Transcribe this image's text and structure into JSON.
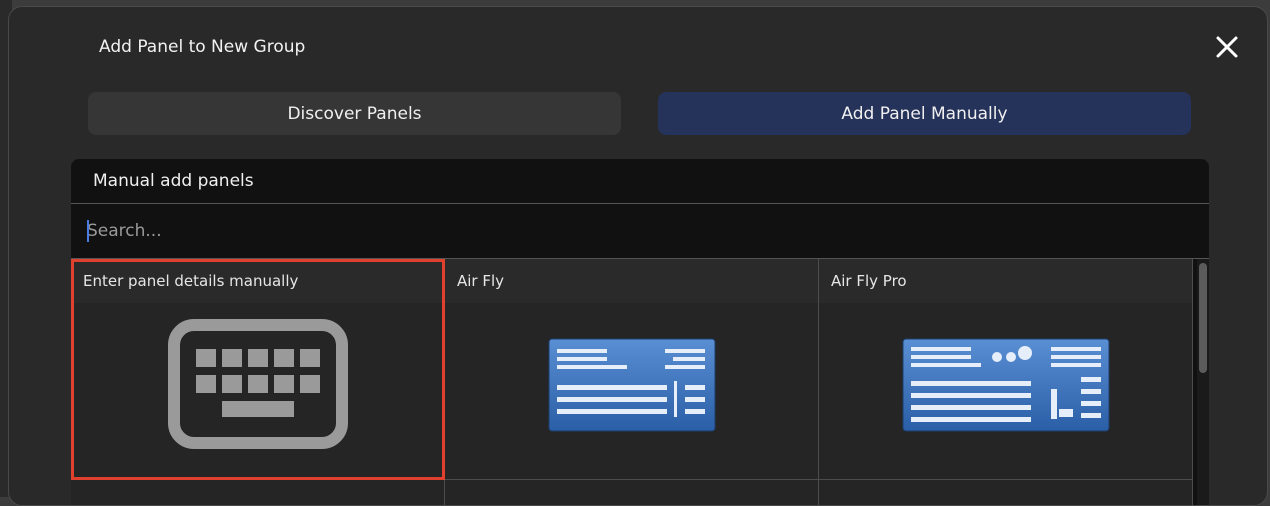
{
  "dialog": {
    "title": "Add Panel to New Group",
    "close_icon": "close-icon"
  },
  "tabs": {
    "discover_label": "Discover Panels",
    "manual_label": "Add Panel Manually",
    "active": "Add Panel Manually"
  },
  "panel": {
    "header": "Manual add panels",
    "search_placeholder": "Search..."
  },
  "tiles": [
    {
      "label": "Enter panel details manually",
      "icon": "keyboard-icon",
      "selected": true
    },
    {
      "label": "Air Fly",
      "icon": "air-fly-panel-image"
    },
    {
      "label": "Air Fly Pro",
      "icon": "air-fly-pro-panel-image"
    }
  ],
  "colors": {
    "accent_active_tab": "#25325a",
    "selection_outline": "#e0412f"
  }
}
